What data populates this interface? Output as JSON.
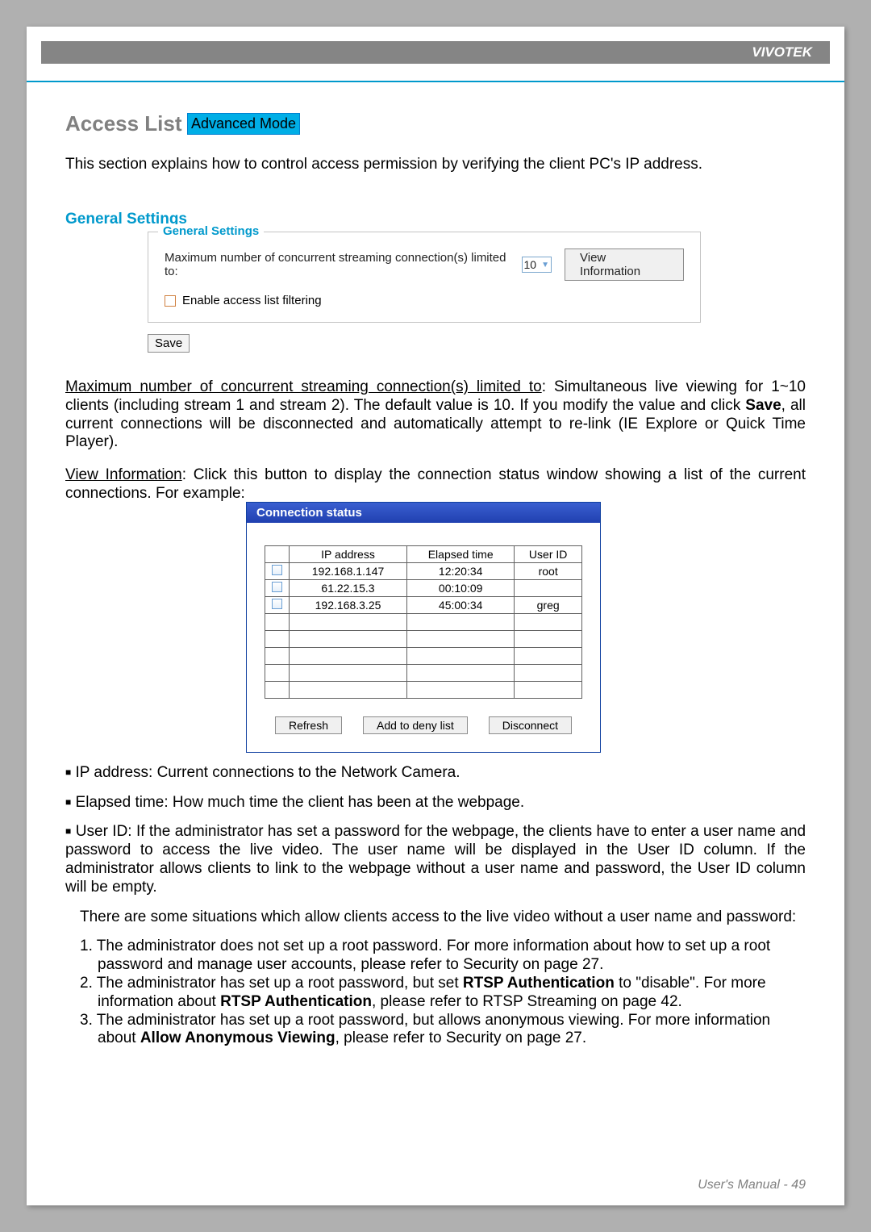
{
  "brand": "VIVOTEK",
  "title": "Access List",
  "badge": "Advanced Mode",
  "intro": "This section explains how to control access permission by verifying the client PC's IP address.",
  "section_heading": "General Settings",
  "gs": {
    "legend": "General Settings",
    "max_label": "Maximum number of concurrent streaming connection(s) limited to:",
    "max_value": "10",
    "view_info": "View Information",
    "enable_filter": "Enable access list filtering",
    "save": "Save"
  },
  "para_max": {
    "u": "Maximum number of concurrent streaming connection(s) limited to",
    "rest": ": Simultaneous live viewing for 1~10 clients (including stream 1 and stream 2). The default value is 10. If you modify the value and click ",
    "save_b": "Save",
    "rest2": ", all current connections will be disconnected and automatically attempt to re-link (IE Explore or Quick Time Player)."
  },
  "para_view": {
    "u": "View Information",
    "rest": ": Click this button to display the connection status window showing a list of the current connections. For example:"
  },
  "conn": {
    "title": "Connection status",
    "headers": [
      "",
      "IP address",
      "Elapsed time",
      "User ID"
    ],
    "rows": [
      {
        "cb": true,
        "ip": "192.168.1.147",
        "et": "12:20:34",
        "uid": "root"
      },
      {
        "cb": true,
        "ip": "61.22.15.3",
        "et": "00:10:09",
        "uid": ""
      },
      {
        "cb": true,
        "ip": "192.168.3.25",
        "et": "45:00:34",
        "uid": "greg"
      },
      {
        "cb": false,
        "ip": "",
        "et": "",
        "uid": ""
      },
      {
        "cb": false,
        "ip": "",
        "et": "",
        "uid": ""
      },
      {
        "cb": false,
        "ip": "",
        "et": "",
        "uid": ""
      },
      {
        "cb": false,
        "ip": "",
        "et": "",
        "uid": ""
      },
      {
        "cb": false,
        "ip": "",
        "et": "",
        "uid": ""
      }
    ],
    "buttons": {
      "refresh": "Refresh",
      "add_deny": "Add to deny list",
      "disconnect": "Disconnect"
    }
  },
  "bullets": {
    "ip": "IP address: Current connections to the Network Camera.",
    "et": "Elapsed time: How much time the client has been at the webpage.",
    "uid": "User ID: If the administrator has set a password for the webpage, the clients have to enter a user name and password to access the live video. The user name will be displayed in the User ID column. If the administrator allows clients to link to the webpage without a user name and password, the User ID column will be empty.",
    "sit_intro": "There are some situations which allow clients access to the live video without a user name and password:",
    "sit1a": "1. The administrator does not set up a root password. For more information about how to set up a root",
    "sit1b": "password and manage user accounts, please refer to Security on page 27.",
    "sit2a_pre": "2. The administrator has set up a root password, but set ",
    "sit2a_b": "RTSP Authentication",
    "sit2a_post": " to \"disable\". For more",
    "sit2b_pre": "information about ",
    "sit2b_b": "RTSP Authentication",
    "sit2b_post": ", please refer to RTSP Streaming on page 42.",
    "sit3a": "3. The administrator has set up a root password, but allows anonymous viewing. For more information",
    "sit3b_pre": "about ",
    "sit3b_b": "Allow Anonymous Viewing",
    "sit3b_post": ", please refer to Security on page 27."
  },
  "footer": {
    "label": "User's Manual - ",
    "page": "49"
  }
}
